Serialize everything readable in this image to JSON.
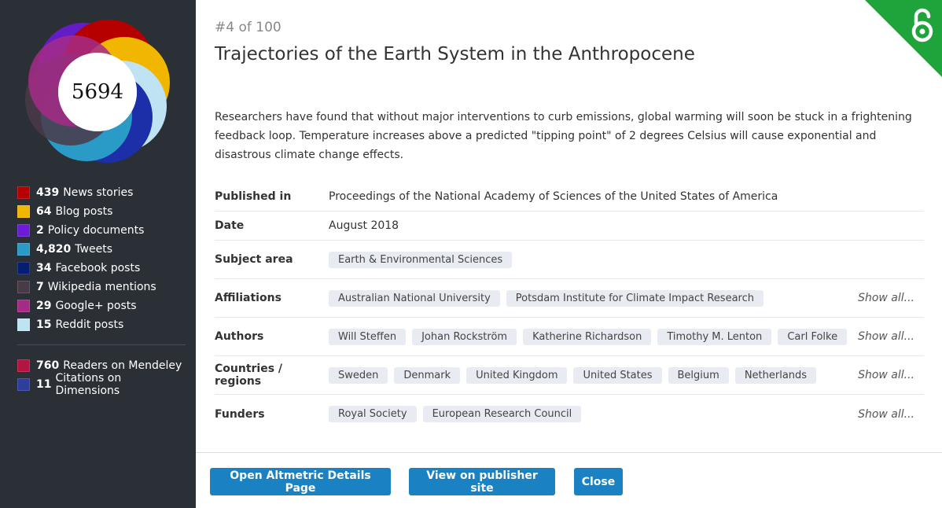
{
  "score": "5694",
  "stats": [
    {
      "count": "439",
      "label": "News stories",
      "color": "#b60000"
    },
    {
      "count": "64",
      "label": "Blog posts",
      "color": "#f1b600"
    },
    {
      "count": "2",
      "label": "Policy documents",
      "color": "#6a1cd6"
    },
    {
      "count": "4,820",
      "label": "Tweets",
      "color": "#2a9bc7"
    },
    {
      "count": "34",
      "label": "Facebook posts",
      "color": "#071d72"
    },
    {
      "count": "7",
      "label": "Wikipedia mentions",
      "color": "#4a3a47"
    },
    {
      "count": "29",
      "label": "Google+ posts",
      "color": "#a52b87"
    },
    {
      "count": "15",
      "label": "Reddit posts",
      "color": "#bfe3f2"
    }
  ],
  "readers": [
    {
      "count": "760",
      "label": "Readers on Mendeley",
      "color": "#b5143f"
    },
    {
      "count": "11",
      "label": "Citations on Dimensions",
      "color": "#2d3f9a"
    }
  ],
  "rank": "#4 of 100",
  "title": "Trajectories of the Earth System in the Anthropocene",
  "abstract": "Researchers have found that without major interventions to curb emissions, global warming will soon be stuck in a frightening feedback loop. Temperature increases above a predicted \"tipping point\" of 2 degrees Celsius will cause exponential and disastrous climate change effects.",
  "details": {
    "published_label": "Published in",
    "published_value": "Proceedings of the National Academy of Sciences of the United States of America",
    "date_label": "Date",
    "date_value": "August 2018",
    "subject_label": "Subject area",
    "subject_tags": [
      "Earth & Environmental Sciences"
    ],
    "affiliations_label": "Affiliations",
    "affiliations_tags": [
      "Australian National University",
      "Potsdam Institute for Climate Impact Research"
    ],
    "authors_label": "Authors",
    "authors_tags": [
      "Will Steffen",
      "Johan Rockström",
      "Katherine Richardson",
      "Timothy M. Lenton",
      "Carl Folke"
    ],
    "countries_label": "Countries / regions",
    "countries_tags": [
      "Sweden",
      "Denmark",
      "United Kingdom",
      "United States",
      "Belgium",
      "Netherlands"
    ],
    "funders_label": "Funders",
    "funders_tags": [
      "Royal Society",
      "European Research Council"
    ],
    "show_all": "Show all..."
  },
  "buttons": {
    "details": "Open Altmetric Details Page",
    "publisher": "View on publisher site",
    "close": "Close"
  },
  "icons": {
    "open_access": "open-access-lock-icon"
  },
  "colors": {
    "sidebar": "#2b3036",
    "button": "#1a82c3",
    "open_access": "#1fa33b"
  }
}
